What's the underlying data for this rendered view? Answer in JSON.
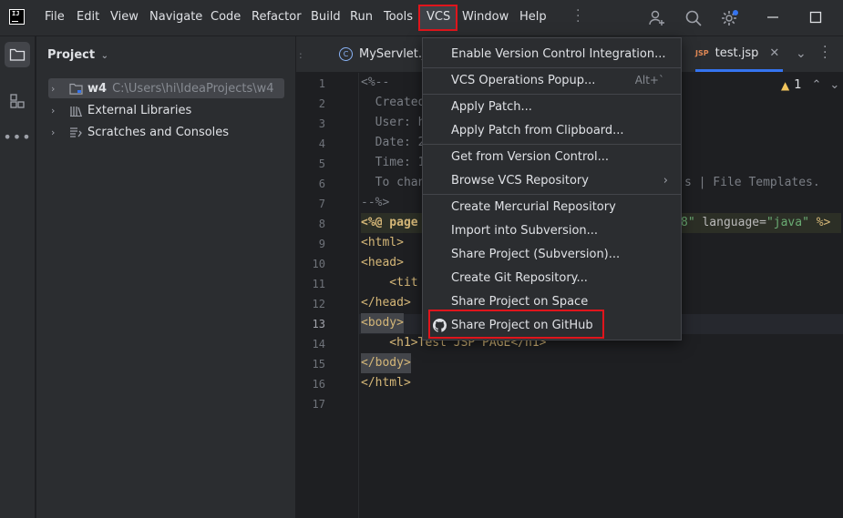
{
  "menubar": {
    "logo_text": "IJ",
    "items": [
      {
        "label": "File"
      },
      {
        "label": "Edit"
      },
      {
        "label": "View"
      },
      {
        "label": "Navigate"
      },
      {
        "label": "Code"
      },
      {
        "label": "Refactor"
      },
      {
        "label": "Build"
      },
      {
        "label": "Run"
      },
      {
        "label": "Tools"
      },
      {
        "label": "VCS"
      },
      {
        "label": "Window"
      },
      {
        "label": "Help"
      }
    ],
    "right_icons": [
      "add-user-icon",
      "search-icon",
      "settings-gear-icon"
    ],
    "window_controls": [
      "minimize-icon",
      "maximize-icon"
    ]
  },
  "tool_strip": {
    "icons": [
      "project-folder-icon",
      "structure-icon",
      "more-tools-icon"
    ]
  },
  "project_panel": {
    "title": "Project",
    "tree": [
      {
        "label": "w4",
        "path": "C:\\Users\\hi\\IdeaProjects\\w4",
        "icon": "module-folder-icon"
      },
      {
        "label": "External Libraries",
        "icon": "library-icon"
      },
      {
        "label": "Scratches and Consoles",
        "icon": "scratches-icon"
      }
    ]
  },
  "editor": {
    "tabs": [
      {
        "label": "MyServlet.j",
        "icon": "class-icon"
      },
      {
        "label": "test.jsp",
        "icon": "jsp-icon",
        "icon_text": "JSP"
      }
    ],
    "warning_count": "1",
    "line_numbers": [
      "1",
      "2",
      "3",
      "4",
      "5",
      "6",
      "7",
      "8",
      "9",
      "10",
      "11",
      "12",
      "13",
      "14",
      "15",
      "16",
      "17"
    ],
    "current_line": "13",
    "code_lines": [
      "<%--",
      "  Created",
      "  User: h",
      "  Date: 2",
      "  Time: 1",
      "  To chan",
      "--%>",
      "<%@ page",
      "<html>",
      "<head>",
      "    <tit",
      "</head>",
      "<body>",
      "    <h1>Test JSP PAGE</h1>",
      "</body>",
      "</html>",
      ""
    ],
    "visible_right_fragments": {
      "line6": "s | File Templates.",
      "line8_quote": "8\"",
      "line8_attr": "language=",
      "line8_val": "\"java\"",
      "line8_end": "%>"
    }
  },
  "vcs_menu": {
    "items": [
      {
        "label": "Enable Version Control Integration...",
        "shortcut": ""
      },
      {
        "label": "VCS Operations Popup...",
        "shortcut": "Alt+`"
      },
      {
        "label": "Apply Patch...",
        "shortcut": ""
      },
      {
        "label": "Apply Patch from Clipboard...",
        "shortcut": ""
      },
      {
        "label": "Get from Version Control...",
        "shortcut": ""
      },
      {
        "label": "Browse VCS Repository",
        "shortcut": "",
        "submenu": true
      },
      {
        "label": "Create Mercurial Repository",
        "shortcut": ""
      },
      {
        "label": "Import into Subversion...",
        "shortcut": ""
      },
      {
        "label": "Share Project (Subversion)...",
        "shortcut": ""
      },
      {
        "label": "Create Git Repository...",
        "shortcut": ""
      },
      {
        "label": "Share Project on Space",
        "shortcut": ""
      },
      {
        "label": "Share Project on GitHub",
        "shortcut": "",
        "icon": "github-icon"
      }
    ]
  },
  "colors": {
    "highlight_box": "#e0151c",
    "accent": "#3574f0"
  }
}
